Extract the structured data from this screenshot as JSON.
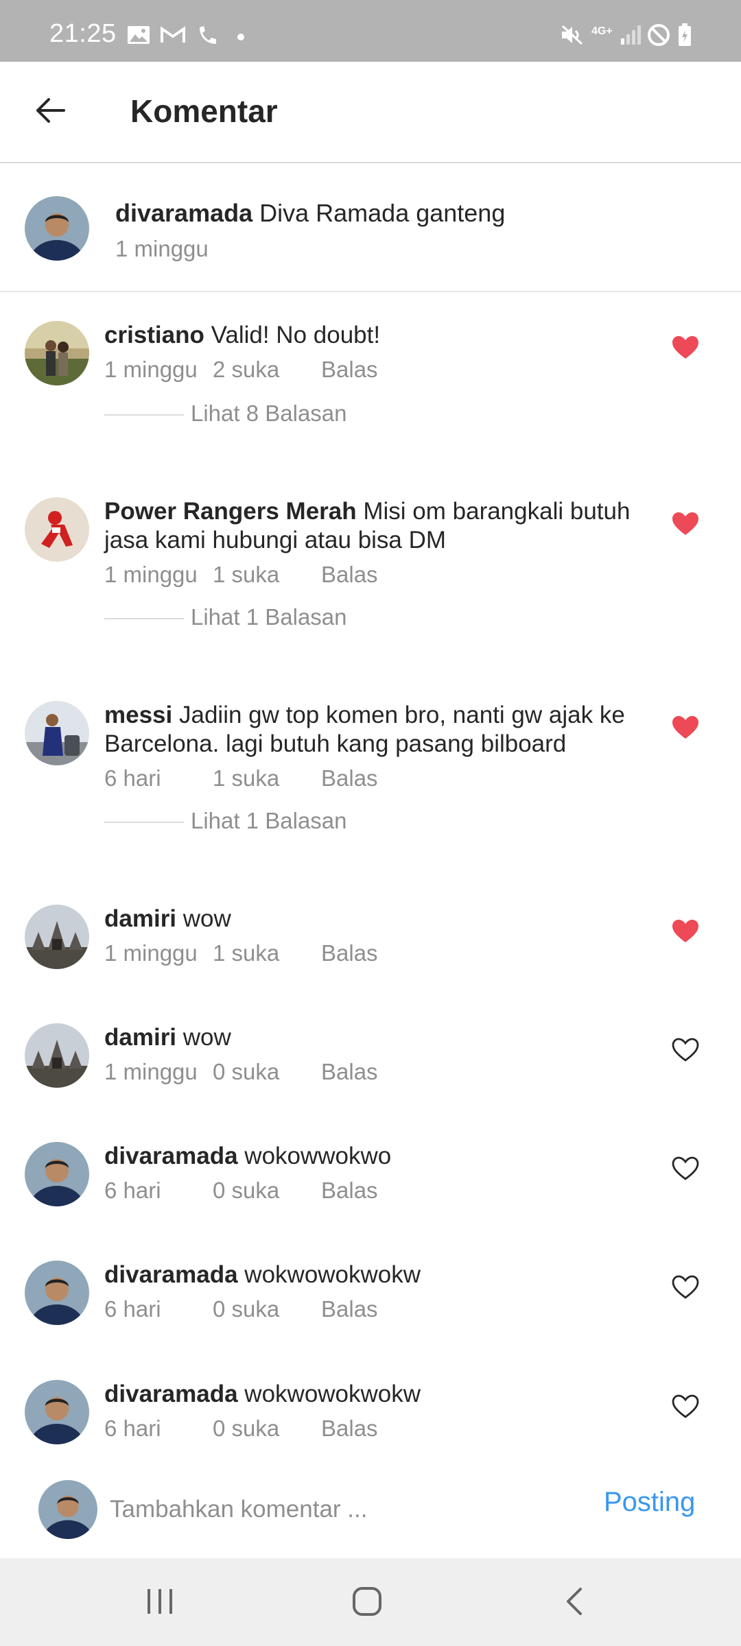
{
  "status_bar": {
    "time": "21:25",
    "network": "4G+",
    "icons": [
      "image-icon",
      "gmail-icon",
      "missed-call-icon",
      "dot-icon",
      "mute-icon",
      "signal-icon",
      "dnd-icon",
      "battery-icon"
    ]
  },
  "header": {
    "back_icon": "arrow-left-icon",
    "title": "Komentar"
  },
  "caption": {
    "username": "divaramada",
    "text": "Diva Ramada ganteng",
    "time": "1 minggu"
  },
  "comments": [
    {
      "username": "cristiano",
      "text": "Valid! No doubt!",
      "time": "1 minggu",
      "likes": "2 suka",
      "reply": "Balas",
      "liked": true,
      "view_replies": "Lihat 8 Balasan"
    },
    {
      "username": "Power Rangers Merah",
      "text": "Misi om barangkali butuh jasa kami hubungi atau bisa DM",
      "time": "1 minggu",
      "likes": "1 suka",
      "reply": "Balas",
      "liked": true,
      "view_replies": "Lihat 1 Balasan"
    },
    {
      "username": "messi",
      "text": "Jadiin gw top komen bro, nanti gw ajak ke Barcelona. lagi butuh kang pasang bilboard",
      "time": "6 hari",
      "likes": "1 suka",
      "reply": "Balas",
      "liked": true,
      "view_replies": "Lihat 1 Balasan"
    },
    {
      "username": "damiri",
      "text": "wow",
      "time": "1 minggu",
      "likes": "1 suka",
      "reply": "Balas",
      "liked": true
    },
    {
      "username": "damiri",
      "text": "wow",
      "time": "1 minggu",
      "likes": "0 suka",
      "reply": "Balas",
      "liked": false
    },
    {
      "username": "divaramada",
      "text": "wokowwokwo",
      "time": "6 hari",
      "likes": "0 suka",
      "reply": "Balas",
      "liked": false
    },
    {
      "username": "divaramada",
      "text": "wokwowokwokw",
      "time": "6 hari",
      "likes": "0 suka",
      "reply": "Balas",
      "liked": false
    },
    {
      "username": "divaramada",
      "text": "wokwowokwokw",
      "time": "6 hari",
      "likes": "0 suka",
      "reply": "Balas",
      "liked": false
    }
  ],
  "composer": {
    "placeholder": "Tambahkan komentar ...",
    "value": "",
    "post_label": "Posting"
  },
  "colors": {
    "heart_liked": "#ed4956",
    "post_blue": "#3897f0",
    "muted_text": "#8e8e8e"
  }
}
